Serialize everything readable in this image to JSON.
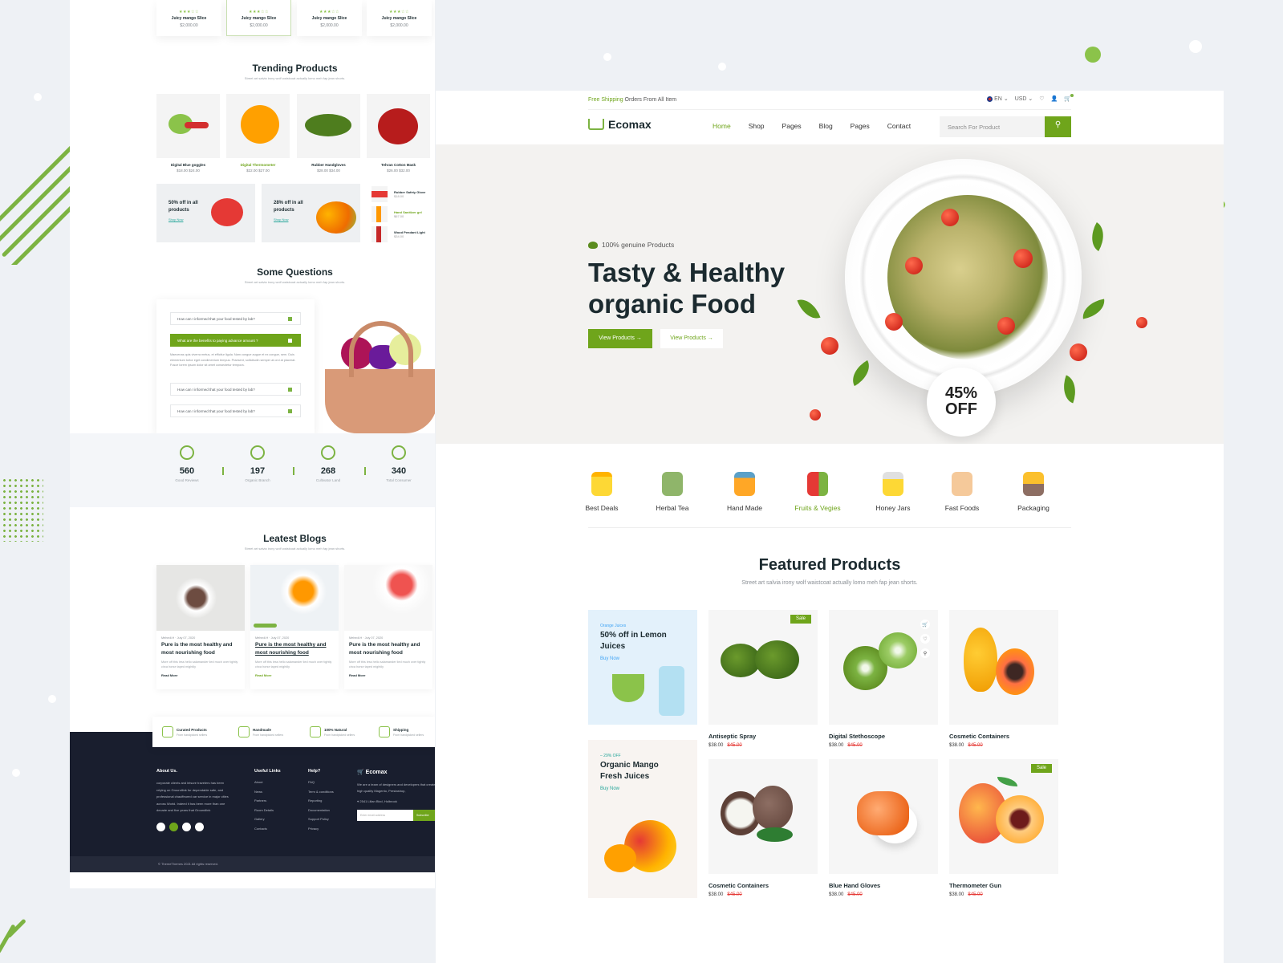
{
  "left_page": {
    "top_products": [
      {
        "name": "Juicy mango Slice",
        "price": "$2,000.00",
        "rating": 3
      },
      {
        "name": "Juicy mango Slice",
        "price": "$2,000.00",
        "rating": 3
      },
      {
        "name": "Juicy mango Slice",
        "price": "$2,000.00",
        "rating": 3
      },
      {
        "name": "Juicy mango Slice",
        "price": "$2,000.00",
        "rating": 3
      }
    ],
    "trending": {
      "title": "Trending Products",
      "subtitle": "Street art salvia irony wolf waistcoat actually lomo meh fap jean shorts.",
      "products": [
        {
          "name": "Digital Blue goggles",
          "price": "$18.00",
          "old_price": "$24.00"
        },
        {
          "name": "Digital Thermometer",
          "price": "$22.00",
          "old_price": "$27.00",
          "highlighted": true
        },
        {
          "name": "Rubber Handgloves",
          "price": "$28.00",
          "old_price": "$34.00"
        },
        {
          "name": "Tehran Cotton Mask",
          "price": "$26.00",
          "old_price": "$32.00"
        }
      ],
      "promos": [
        {
          "title": "50% off in all products",
          "link": "Shop Now"
        },
        {
          "title": "28% off in all products",
          "link": "Shop Now"
        }
      ],
      "side_list": [
        {
          "name": "Rubber Safety Glove",
          "price": "$18.00"
        },
        {
          "name": "Hand Sanitizer gel",
          "price": "$67.00",
          "highlighted": true
        },
        {
          "name": "Wood Pendant Light",
          "price": "$34.00"
        }
      ]
    },
    "faq": {
      "title": "Some Questions",
      "subtitle": "Street art salvia irony wolf waistcoat actually lomo meh fap jean shorts.",
      "items": [
        {
          "q": "How can I informed that your food tested by lab?",
          "open": false
        },
        {
          "q": "What are the benefits to paying advance amount ?",
          "open": true
        },
        {
          "q": "How can I informed that your food tested by lab?",
          "open": false
        },
        {
          "q": "How can I informed that your food tested by lab?",
          "open": false
        }
      ],
      "answer": "Maecenas quis viverra metus, et efficitur ligula. Nam congue augue et ex congue, sem. Duis elementum tortor eget condimentum tempus. Praesent, sollicitudin semper at orci at placerat. Fusce lorem ipsum dolor sit amet consectetur tempora."
    },
    "stats": [
      {
        "value": "560",
        "label": "Good Reviews",
        "icon": "heart-chat-icon"
      },
      {
        "value": "197",
        "label": "Organic Branch",
        "icon": "plant-branch-icon"
      },
      {
        "value": "268",
        "label": "Cultivator Land",
        "icon": "sprout-icon"
      },
      {
        "value": "340",
        "label": "Total Consumer",
        "icon": "hand-user-icon"
      }
    ],
    "blogs": {
      "title": "Leatest Blogs",
      "subtitle": "Street art salvia irony wolf waistcoat actually lomo meh fap jean shorts.",
      "items": [
        {
          "author": "Mehedi.H",
          "date": "July 07, 2020",
          "title": "Pure is the most healthy and most nourishing food",
          "excerpt": "More off this less hello salamander lied much over tightly circa horse taped mightily",
          "read_more": "Read More"
        },
        {
          "author": "Mehedi.H",
          "date": "July 07, 2020",
          "title": "Pure is the most healthy and most nourishing food",
          "excerpt": "More off this less hello salamander lied much over tightly circa horse taped mightily",
          "read_more": "Read More"
        },
        {
          "author": "Mehedi.H",
          "date": "July 07, 2020",
          "title": "Pure is the most healthy and most nourishing food",
          "excerpt": "More off this less hello salamander lied much over tightly circa horse taped mightily",
          "read_more": "Read More"
        }
      ]
    },
    "features": [
      {
        "title": "Curated Products",
        "sub": "From handpicked sellers"
      },
      {
        "title": "Handmade",
        "sub": "From handpicked sellers"
      },
      {
        "title": "100% Natural",
        "sub": "From handpicked sellers"
      },
      {
        "title": "Shipping",
        "sub": "From handpicked sellers"
      }
    ],
    "footer": {
      "about_title": "About Us.",
      "about_text": "corporate clients and leisure travelers has been relying on Groundlink for dependable safe, and professional chauffeured car service in major cities across World. Indeed it has been more than one decade and five years that Groundlink",
      "useful_title": "Useful Links",
      "useful_links": [
        "About",
        "News",
        "Partners",
        "Room Details",
        "Gallery",
        "Contacts"
      ],
      "help_title": "Help?",
      "help_links": [
        "FAQ",
        "Term & conditions",
        "Reporting",
        "Documentation",
        "Support Policy",
        "Privacy"
      ],
      "brand": "Ecomax",
      "brand_text": "We are a team of designers and developers that create high quality Magento, Prestashop,",
      "address": "2541 Lilian Blvd, Holbrook",
      "email_placeholder": "Enter email address",
      "subscribe": "Subscribe",
      "copyright": "© ThemeThemes 2021 All rights reserved."
    }
  },
  "main_page": {
    "topbar": {
      "shipping_highlight": "Free Shipping",
      "shipping_text": " Orders From All Item",
      "language": "EN",
      "currency": "USD"
    },
    "nav": {
      "brand": "Ecomax",
      "links": [
        "Home",
        "Shop",
        "Pages",
        "Blog",
        "Pages",
        "Contact"
      ],
      "active_index": 0,
      "search_placeholder": "Search For Product"
    },
    "hero": {
      "tagline": "100% genuine Products",
      "title_line1": "Tasty & Healthy",
      "title_line2": "organic Food",
      "primary_button": "View Products →",
      "secondary_button": "View Products →",
      "badge_line1": "45%",
      "badge_line2": "OFF"
    },
    "categories": [
      {
        "label": "Best Deals",
        "icon": "juice-glass-icon",
        "active": false
      },
      {
        "label": "Herbal Tea",
        "icon": "tea-jar-icon",
        "active": false
      },
      {
        "label": "Hand Made",
        "icon": "syrup-bottle-icon",
        "active": false
      },
      {
        "label": "Fruits & Vegies",
        "icon": "fruits-vegetables-icon",
        "active": true
      },
      {
        "label": "Honey Jars",
        "icon": "honey-cup-icon",
        "active": false
      },
      {
        "label": "Fast Foods",
        "icon": "sandwich-icon",
        "active": false
      },
      {
        "label": "Packaging",
        "icon": "package-box-icon",
        "active": false
      }
    ],
    "featured": {
      "title": "Featured Products",
      "subtitle": "Street art salvia irony wolf waistcoat actually lomo meh fap jean shorts.",
      "banners": [
        {
          "small": "Orange Juices",
          "title": "50% off in Lemon Juices",
          "link": "Buy Now"
        },
        {
          "small": "– 29% OFF",
          "title": "Organic Mango Fresh Juices",
          "link": "Buy Now"
        }
      ],
      "products": [
        {
          "name": "Antiseptic Spray",
          "price": "$38.00",
          "old_price": "$45.00",
          "sale": true,
          "image": "broccoli"
        },
        {
          "name": "Digital Stethoscope",
          "price": "$38.00",
          "old_price": "$45.00",
          "sale": false,
          "image": "kiwi"
        },
        {
          "name": "Cosmetic Containers",
          "price": "$38.00",
          "old_price": "$45.00",
          "sale": false,
          "image": "papaya"
        },
        {
          "name": "Cosmetic Containers",
          "price": "$38.00",
          "old_price": "$45.00",
          "sale": false,
          "image": "coconut"
        },
        {
          "name": "Blue Hand Gloves",
          "price": "$38.00",
          "old_price": "$45.00",
          "sale": false,
          "image": "shrimp"
        },
        {
          "name": "Thermometer Gun",
          "price": "$38.00",
          "old_price": "$45.00",
          "sale": true,
          "image": "peach"
        }
      ],
      "sale_label": "Sale"
    }
  }
}
